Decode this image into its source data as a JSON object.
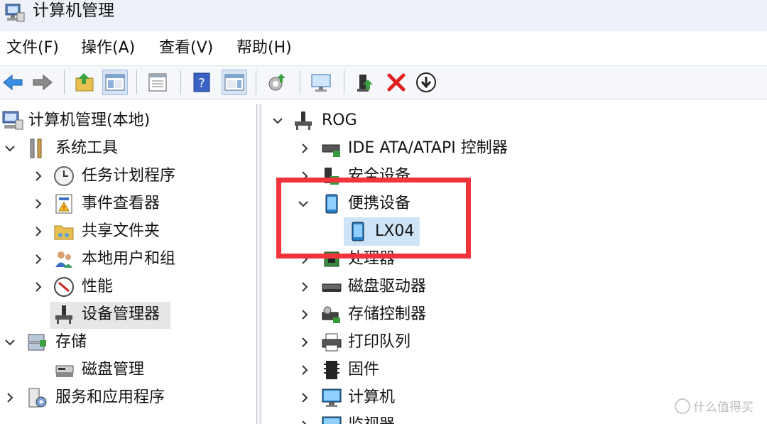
{
  "window": {
    "title": "计算机管理"
  },
  "menu": [
    {
      "label": "文件(F)"
    },
    {
      "label": "操作(A)"
    },
    {
      "label": "查看(V)"
    },
    {
      "label": "帮助(H)"
    }
  ],
  "toolbar": {
    "buttons": [
      "back-arrow-icon",
      "forward-arrow-icon",
      "up-folder-icon",
      "show-tree-icon",
      "properties-icon",
      "help-icon",
      "show-action-pane-icon",
      "scan-hardware-icon",
      "monitor-icon",
      "update-driver-icon",
      "uninstall-icon",
      "disable-device-icon"
    ]
  },
  "left_tree": {
    "root": "计算机管理(本地)",
    "system_tools": "系统工具",
    "task_scheduler": "任务计划程序",
    "event_viewer": "事件查看器",
    "shared_folders": "共享文件夹",
    "local_users": "本地用户和组",
    "performance": "性能",
    "device_manager": "设备管理器",
    "storage": "存储",
    "disk_management": "磁盘管理",
    "services_apps": "服务和应用程序"
  },
  "device_tree": {
    "computer": "ROG",
    "ide": "IDE ATA/ATAPI 控制器",
    "security": "安全设备",
    "portable": "便携设备",
    "lx04": "LX04",
    "processor": "处理器",
    "disk_drives": "磁盘驱动器",
    "storage_ctrl": "存储控制器",
    "print_queue": "打印队列",
    "firmware": "固件",
    "computer_node": "计算机",
    "monitor": "监视器"
  },
  "colors": {
    "highlight_border": "#f2333b",
    "selection_blue": "#cde4f7",
    "selection_gray": "#e6e6e6"
  },
  "watermark": {
    "text": "什么值得买"
  }
}
